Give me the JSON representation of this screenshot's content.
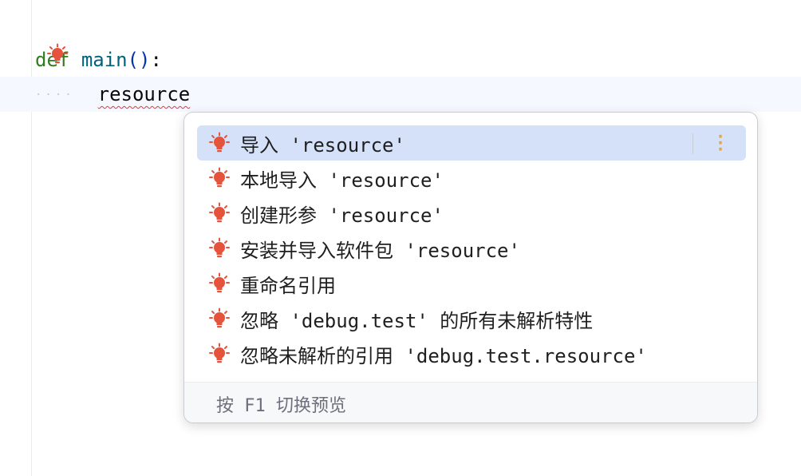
{
  "editor": {
    "line1": {
      "keyword": "def",
      "function_name": "main",
      "parens": "()",
      "colon": ":"
    },
    "line2": {
      "indent": "····",
      "identifier": "resource"
    }
  },
  "popup": {
    "items": [
      {
        "label": "导入 'resource'",
        "icon": "lightbulb-error-icon",
        "selected": true
      },
      {
        "label": "本地导入 'resource'",
        "icon": "lightbulb-error-icon"
      },
      {
        "label": "创建形参 'resource'",
        "icon": "lightbulb-error-icon"
      },
      {
        "label": "安装并导入软件包 'resource'",
        "icon": "lightbulb-error-icon"
      },
      {
        "label": "重命名引用",
        "icon": "lightbulb-error-icon"
      },
      {
        "label": "忽略 'debug.test' 的所有未解析特性",
        "icon": "lightbulb-error-icon"
      },
      {
        "label": "忽略未解析的引用 'debug.test.resource'",
        "icon": "lightbulb-error-icon"
      }
    ],
    "more_icon": "more-vertical-icon",
    "footer_hint": "按 F1 切换预览"
  },
  "colors": {
    "error_bulb": "#e5533d",
    "selection": "#d5e1f8",
    "more_icon": "#e8a33d",
    "error_underline": "#e53935"
  }
}
